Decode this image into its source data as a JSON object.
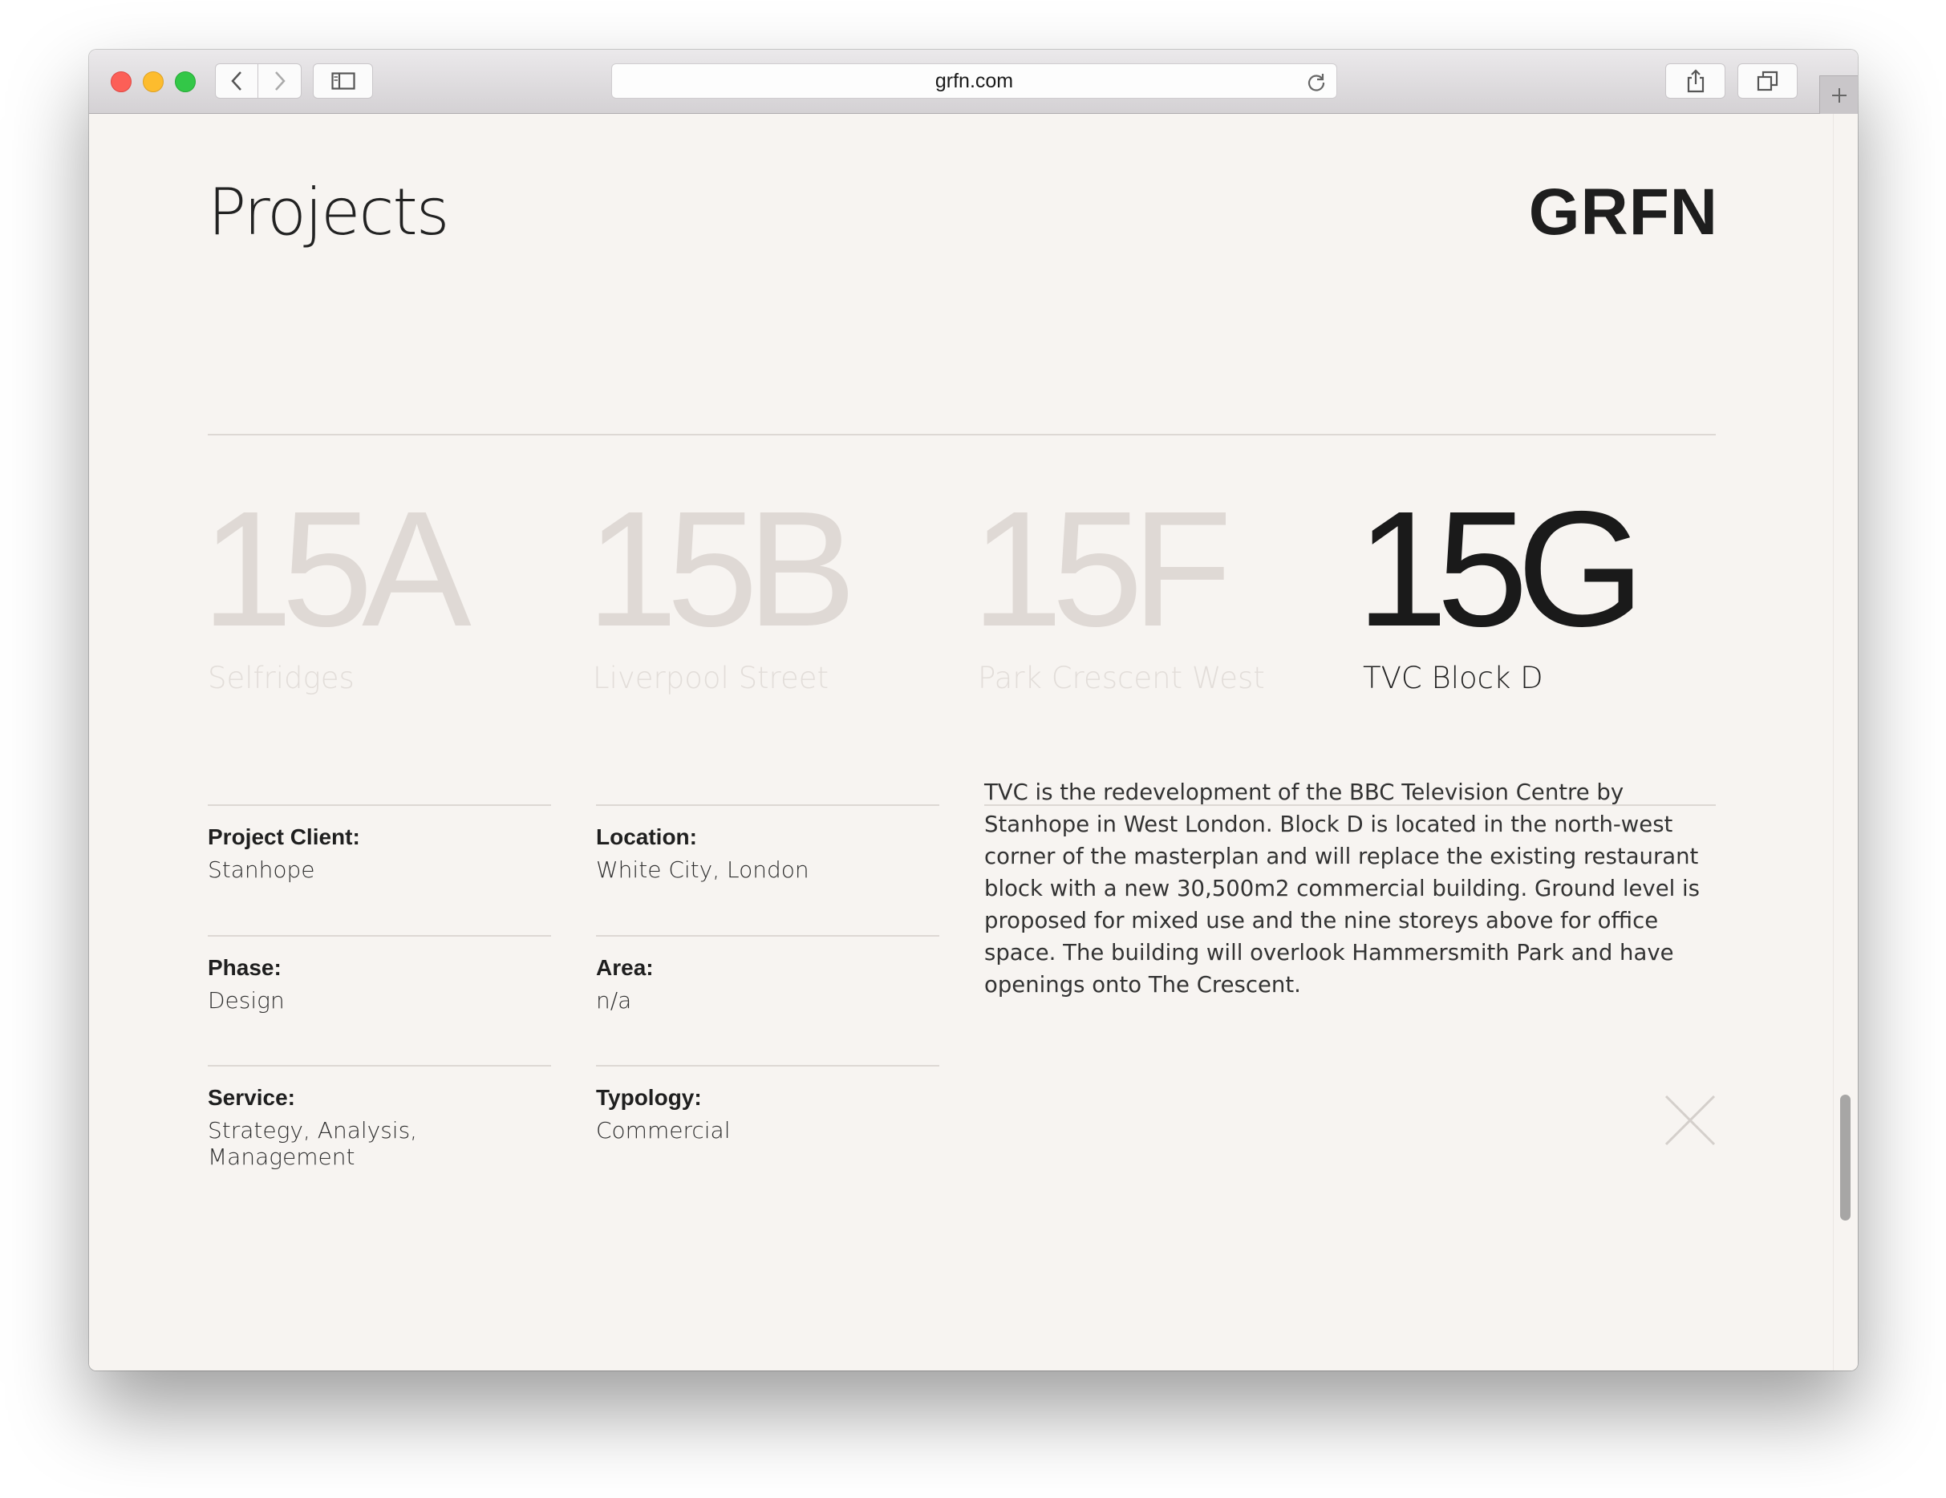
{
  "browser": {
    "url": "grfn.com"
  },
  "page": {
    "title": "Projects",
    "logo": "GRFN"
  },
  "projects": [
    {
      "code": "15A",
      "name": "Selfridges",
      "active": false
    },
    {
      "code": "15B",
      "name": "Liverpool Street",
      "active": false
    },
    {
      "code": "15F",
      "name": "Park Crescent West",
      "active": false
    },
    {
      "code": "15G",
      "name": "TVC Block D",
      "active": true
    }
  ],
  "details": {
    "client": {
      "label": "Project Client:",
      "value": "Stanhope"
    },
    "location": {
      "label": "Location:",
      "value": "White City, London"
    },
    "phase": {
      "label": "Phase:",
      "value": "Design"
    },
    "area": {
      "label": "Area:",
      "value": "n/a"
    },
    "service": {
      "label": "Service:",
      "value": "Strategy, Analysis, Management"
    },
    "typology": {
      "label": "Typology:",
      "value": "Commercial"
    },
    "description": "TVC is the redevelopment of the BBC Television Centre by Stanhope in West London. Block D is located in the north-west corner of the masterplan and will replace the existing restaurant block with a new 30,500m2 commercial building. Ground level is proposed for mixed use and the nine storeys above for office space. The building will overlook Hammersmith Park and have openings onto The Crescent."
  },
  "colors": {
    "page_background": "#f7f4f1",
    "inactive_project": "#dfd9d5",
    "active_project": "#1a1a1a"
  }
}
